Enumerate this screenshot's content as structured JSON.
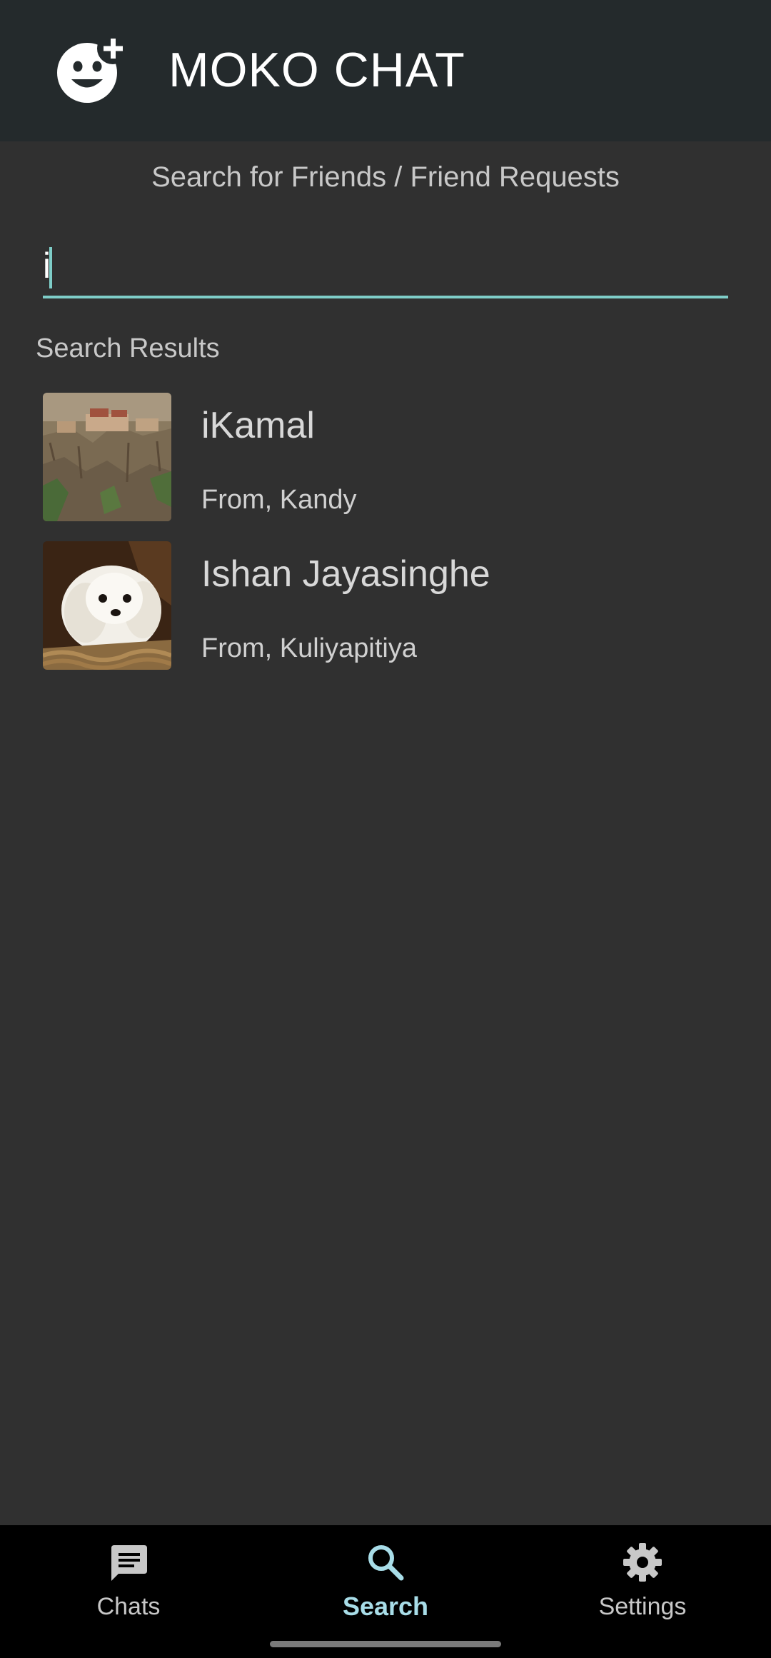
{
  "header": {
    "logo_icon": "add-reaction-icon",
    "title": "MOKO CHAT"
  },
  "search": {
    "subtitle": "Search for Friends / Friend Requests",
    "value": "i",
    "underline_color": "#7ecdc8"
  },
  "results": {
    "label": "Search Results",
    "items": [
      {
        "name": "iKamal",
        "from": "From, Kandy",
        "avatar": "cliff-monastery-photo"
      },
      {
        "name": "Ishan Jayasinghe",
        "from": "From, Kuliyapitiya",
        "avatar": "white-puppy-photo"
      }
    ]
  },
  "nav": {
    "active": "Search",
    "active_color": "#a8dde8",
    "items": [
      {
        "label": "Chats",
        "icon": "chat-icon"
      },
      {
        "label": "Search",
        "icon": "search-icon"
      },
      {
        "label": "Settings",
        "icon": "gear-icon"
      }
    ]
  }
}
